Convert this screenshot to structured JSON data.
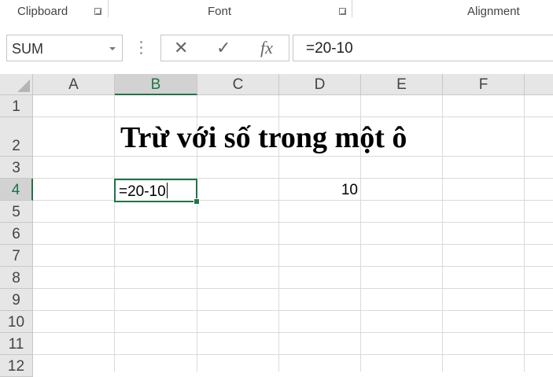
{
  "ribbon": {
    "clipboard_label": "Clipboard",
    "font_label": "Font",
    "alignment_label": "Alignment"
  },
  "formula_bar": {
    "name_box_value": "SUM",
    "cancel_symbol": "✕",
    "enter_symbol": "✓",
    "fx_symbol": "fx",
    "formula_value": "=20-10"
  },
  "columns": [
    "A",
    "B",
    "C",
    "D",
    "E",
    "F"
  ],
  "rows": [
    "1",
    "2",
    "3",
    "4",
    "5",
    "6",
    "7",
    "8",
    "9",
    "10",
    "11",
    "12"
  ],
  "cells": {
    "B2": "Trừ với số trong một ô",
    "B4": "=20-10",
    "D4": "10"
  },
  "selection": {
    "column": "B",
    "row": "4"
  },
  "colors": {
    "accent": "#217346",
    "header_bg": "#e6e6e6",
    "gridline": "#dadada"
  },
  "icons": [
    "dialog-launcher-icon",
    "dropdown-arrow-icon",
    "cancel-icon",
    "enter-check-icon",
    "function-icon"
  ]
}
